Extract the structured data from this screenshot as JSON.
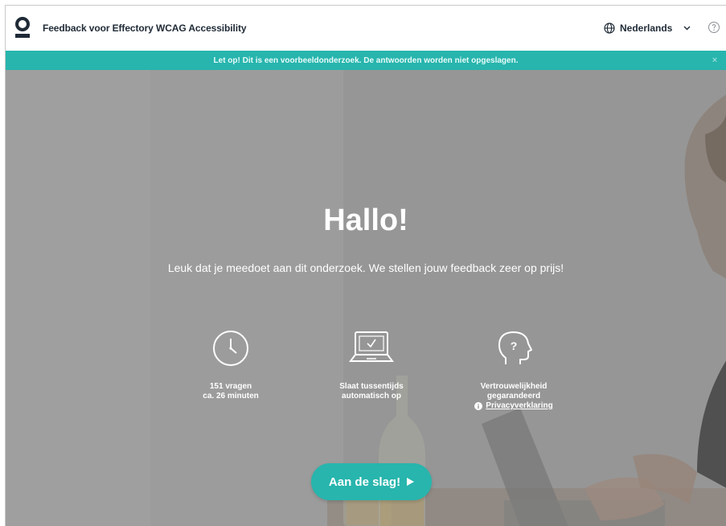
{
  "header": {
    "title": "Feedback voor Effectory WCAG Accessibility",
    "language": "Nederlands"
  },
  "banner": {
    "text": "Let op! Dit is een voorbeeldonderzoek. De antwoorden worden niet opgeslagen.",
    "close": "×"
  },
  "hero": {
    "title": "Hallo!",
    "subtitle": "Leuk dat je meedoet aan dit onderzoek. We stellen jouw feedback zeer op prijs!"
  },
  "features": [
    {
      "line1": "151 vragen",
      "line2": "ca. 26 minuten",
      "icon": "clock-icon"
    },
    {
      "line1": "Slaat tussentijds",
      "line2": "automatisch op",
      "icon": "laptop-check-icon"
    },
    {
      "line1": "Vertrouwelijkheid",
      "line2": "gegarandeerd",
      "link": "Privacyverklaring",
      "icon": "head-question-icon"
    }
  ],
  "start_button": {
    "label": "Aan de slag!"
  },
  "colors": {
    "accent": "#27b5ad",
    "header_text": "#1f2a36",
    "overlay": "#9a9a9a"
  }
}
